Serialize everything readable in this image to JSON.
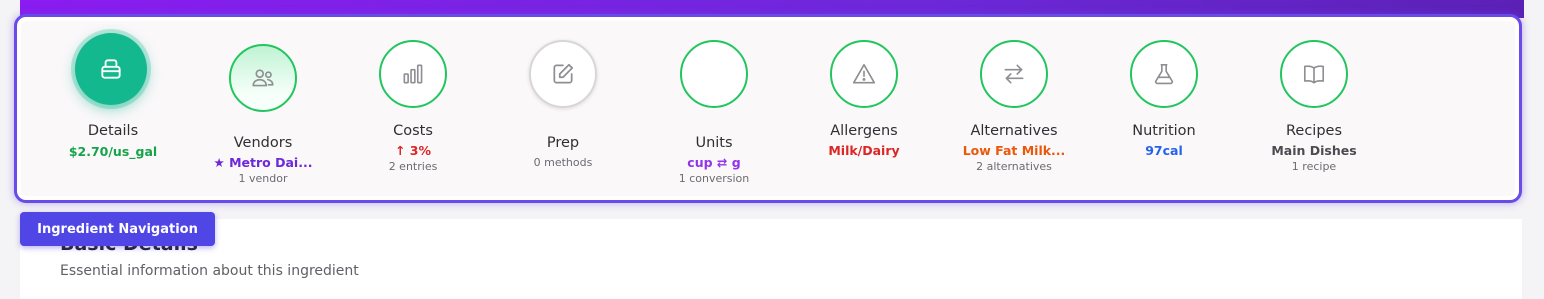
{
  "nav_title": "Ingredient Navigation",
  "section": {
    "title": "Basic Details",
    "subtitle": "Essential information about this ingredient"
  },
  "steps": [
    {
      "label": "Details",
      "value": "$2.70/us_gal",
      "value_color": "#16a34a",
      "sub": "",
      "icon": "package-icon",
      "state": "active"
    },
    {
      "label": "Vendors",
      "value": "★ Metro Dai...",
      "value_color": "#6d28d9",
      "sub": "1 vendor",
      "icon": "users-icon",
      "state": "filled"
    },
    {
      "label": "Costs",
      "value": "↑ 3%",
      "value_color": "#dc2626",
      "sub": "2 entries",
      "icon": "bar-chart-icon",
      "state": "done"
    },
    {
      "label": "Prep",
      "value": "",
      "value_color": "#6b6b70",
      "sub": "0 methods",
      "icon": "pencil-icon",
      "state": "muted"
    },
    {
      "label": "Units",
      "value": "cup ⇄ g",
      "value_color": "#9333ea",
      "sub": "1 conversion",
      "icon": "",
      "state": "done"
    },
    {
      "label": "Allergens",
      "value": "Milk/Dairy",
      "value_color": "#dc2626",
      "sub": "",
      "icon": "warning-icon",
      "state": "done"
    },
    {
      "label": "Alternatives",
      "value": "Low Fat Milk...",
      "value_color": "#ea580c",
      "sub": "2 alternatives",
      "icon": "swap-icon",
      "state": "done"
    },
    {
      "label": "Nutrition",
      "value": "97cal",
      "value_color": "#2563eb",
      "sub": "",
      "icon": "flask-icon",
      "state": "done"
    },
    {
      "label": "Recipes",
      "value": "Main Dishes",
      "value_color": "#4b4b50",
      "sub": "1 recipe",
      "icon": "book-icon",
      "state": "done"
    }
  ]
}
